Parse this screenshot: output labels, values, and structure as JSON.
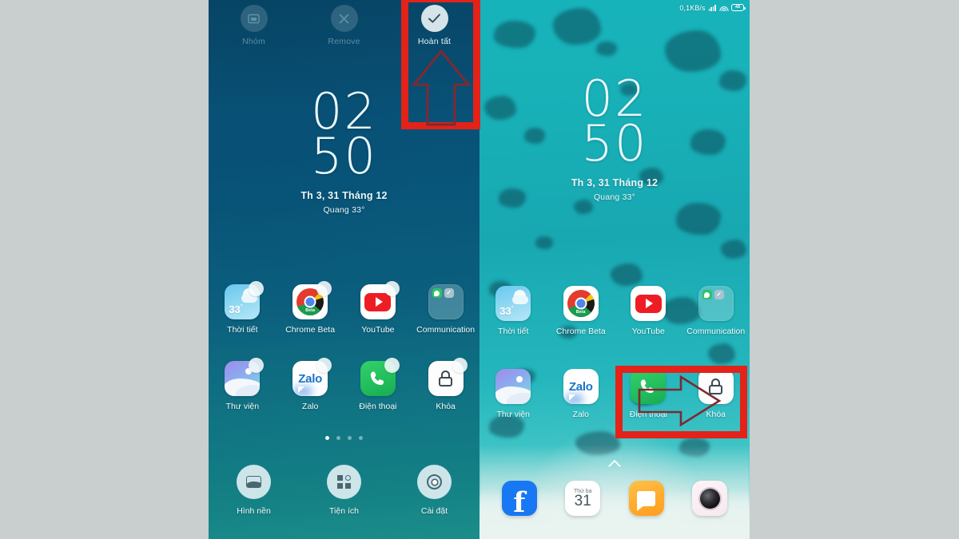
{
  "page": {
    "background_color": "#c9cecf",
    "annotation_color": "#e32219"
  },
  "left_phone": {
    "mode_label": "home-screen-edit-mode",
    "edit_toolbar": [
      {
        "label": "Nhóm",
        "icon": "folder-icon",
        "state": "disabled"
      },
      {
        "label": "Remove",
        "icon": "close-x-icon",
        "state": "disabled"
      },
      {
        "label": "Hoàn tất",
        "icon": "checkmark-icon",
        "state": "enabled"
      }
    ],
    "clock": {
      "hours": "02",
      "minutes": "50",
      "date": "Th 3, 31 Tháng 12",
      "weather": "Quang  33°"
    },
    "apps": [
      {
        "label": "Thời tiết",
        "icon": "weather-icon",
        "badge": true
      },
      {
        "label": "Chrome Beta",
        "icon": "chrome-beta-icon",
        "badge": true
      },
      {
        "label": "YouTube",
        "icon": "youtube-icon",
        "badge": true
      },
      {
        "label": "Communication",
        "icon": "folder-icon",
        "badge": false
      },
      {
        "label": "Thư viện",
        "icon": "gallery-icon",
        "badge": true
      },
      {
        "label": "Zalo",
        "icon": "zalo-icon",
        "badge": true
      },
      {
        "label": "Điện thoại",
        "icon": "phone-icon",
        "badge": true
      },
      {
        "label": "Khóa",
        "icon": "lock-icon",
        "badge": true
      }
    ],
    "page_dots": {
      "count": 4,
      "active_index": 0
    },
    "bottom_tools": [
      {
        "label": "Hình nền",
        "icon": "wallpaper-icon"
      },
      {
        "label": "Tiện ích",
        "icon": "widgets-icon"
      },
      {
        "label": "Cài đặt",
        "icon": "gear-icon"
      }
    ]
  },
  "right_phone": {
    "mode_label": "home-screen-normal",
    "status_bar": {
      "network_speed": "0,1KB/s",
      "signal_icon": "cellular-signal-icon",
      "wifi_icon": "wifi-icon",
      "battery_icon": "battery-icon",
      "battery_level": "48"
    },
    "clock": {
      "hours": "02",
      "minutes": "50",
      "date": "Th 3, 31 Tháng 12",
      "weather": "Quang  33°"
    },
    "apps": [
      {
        "label": "Thời tiết",
        "icon": "weather-icon"
      },
      {
        "label": "Chrome Beta",
        "icon": "chrome-beta-icon"
      },
      {
        "label": "YouTube",
        "icon": "youtube-icon"
      },
      {
        "label": "Communication",
        "icon": "folder-icon"
      },
      {
        "label": "Thư viện",
        "icon": "gallery-icon"
      },
      {
        "label": "Zalo",
        "icon": "zalo-icon"
      },
      {
        "label": "Điện thoại",
        "icon": "phone-icon"
      },
      {
        "label": "Khóa",
        "icon": "lock-icon"
      }
    ],
    "app_drawer_handle": "chevron-up-icon",
    "dock": [
      {
        "label": "Facebook",
        "icon": "facebook-icon",
        "glyph": "f"
      },
      {
        "label": "Lịch",
        "icon": "calendar-icon",
        "weekday": "Thứ ba",
        "day": "31"
      },
      {
        "label": "Tin nhắn",
        "icon": "messages-icon"
      },
      {
        "label": "Máy ảnh",
        "icon": "camera-icon"
      }
    ]
  },
  "annotations": [
    {
      "name": "highlight-done-button",
      "shape": "rectangle",
      "target": "Hoàn tất"
    },
    {
      "name": "arrow-pointing-to-done",
      "shape": "up-arrow",
      "target": "Hoàn tất"
    },
    {
      "name": "highlight-drag-result",
      "shape": "rectangle",
      "target": "Điện thoại → Khóa"
    },
    {
      "name": "arrow-drag-direction",
      "shape": "right-arrow",
      "target": "Điện thoại → Khóa"
    }
  ]
}
